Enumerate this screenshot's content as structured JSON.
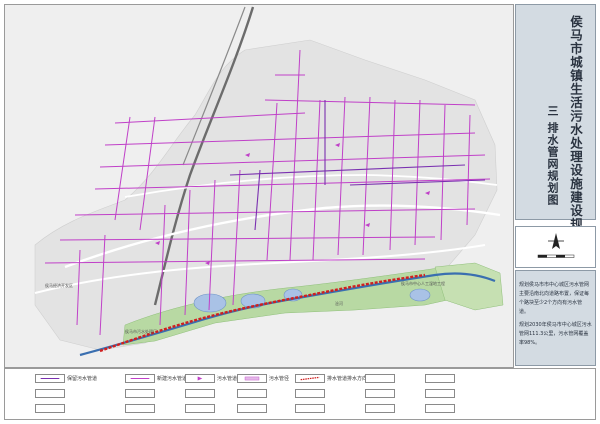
{
  "title": {
    "main": "侯马市城镇生活污水处理设施建设规划",
    "sub": "三 排水管网规划图"
  },
  "notes": [
    "规划侯马市市中心城区污水管网主要沿南北向道路布置，保证每个路块至少2个方向有污水管道。",
    "规划2030年侯马市中心城区污水管网111.3公里，污水管网覆盖率98%。"
  ],
  "legend": {
    "items": [
      {
        "key": "existing",
        "label": "保留污水管道"
      },
      {
        "key": "planned",
        "label": "新建污水管道"
      },
      {
        "key": "flow",
        "label": "污水管道排水方向"
      },
      {
        "key": "pipe_size",
        "label": "污水管径"
      },
      {
        "key": "main_flow",
        "label": "排水管道排水方向"
      }
    ]
  },
  "map": {
    "labels": [
      "侯马经济开发区",
      "浍河",
      "侯马市污水处理厂",
      "侯马市中心人工湿地工程"
    ]
  },
  "colors": {
    "pipe_planned": "#c040c8",
    "pipe_existing": "#7a30b0",
    "main_sewer": "#d02020",
    "river": "#3a6fb0",
    "water": "#a9c2e6",
    "green": "#b8d9a3",
    "road": "#ffffff",
    "block": "#e2e2e2",
    "rail": "#6c6c6c",
    "panel": "#d3dbe2"
  }
}
